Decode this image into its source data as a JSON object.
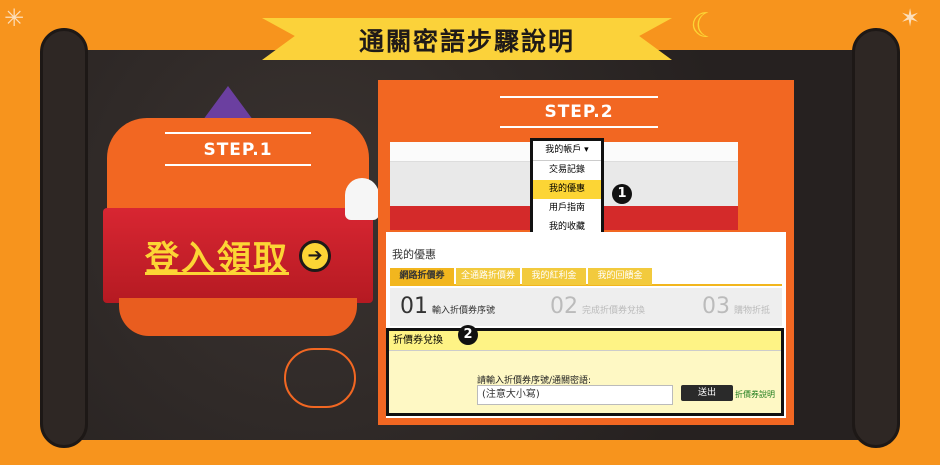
{
  "header": {
    "title": "通關密語步驟說明"
  },
  "step1": {
    "label": "STEP.1",
    "cta": "登入領取"
  },
  "step2": {
    "label": "STEP.2",
    "dropdown": {
      "header": "我的帳戶 ▾",
      "items": [
        "交易記錄",
        "我的優惠",
        "用戶指南",
        "我的收藏"
      ],
      "active_index": 1
    },
    "badge1": "1",
    "offers": {
      "title": "我的優惠",
      "tabs": [
        "網路折價券",
        "全通路折價券",
        "我的紅利金",
        "我的回饋金"
      ],
      "steps": [
        {
          "num": "01",
          "text": "輸入折價券序號"
        },
        {
          "num": "02",
          "text": "完成折價券兌換"
        },
        {
          "num": "03",
          "text": "購物折抵"
        }
      ],
      "badge2": "2",
      "exchange": {
        "head": "折價券兌換",
        "prompt": "請輸入折價券序號/通關密語:",
        "input_value": "(注意大小寫)",
        "submit_label": "送出",
        "help_link": "折價券說明"
      }
    }
  },
  "colors": {
    "background": "#f7941d",
    "board": "#2b2523",
    "accent_yellow": "#fcd535",
    "pumpkin": "#f26722",
    "ribbon_red": "#d0202b"
  }
}
